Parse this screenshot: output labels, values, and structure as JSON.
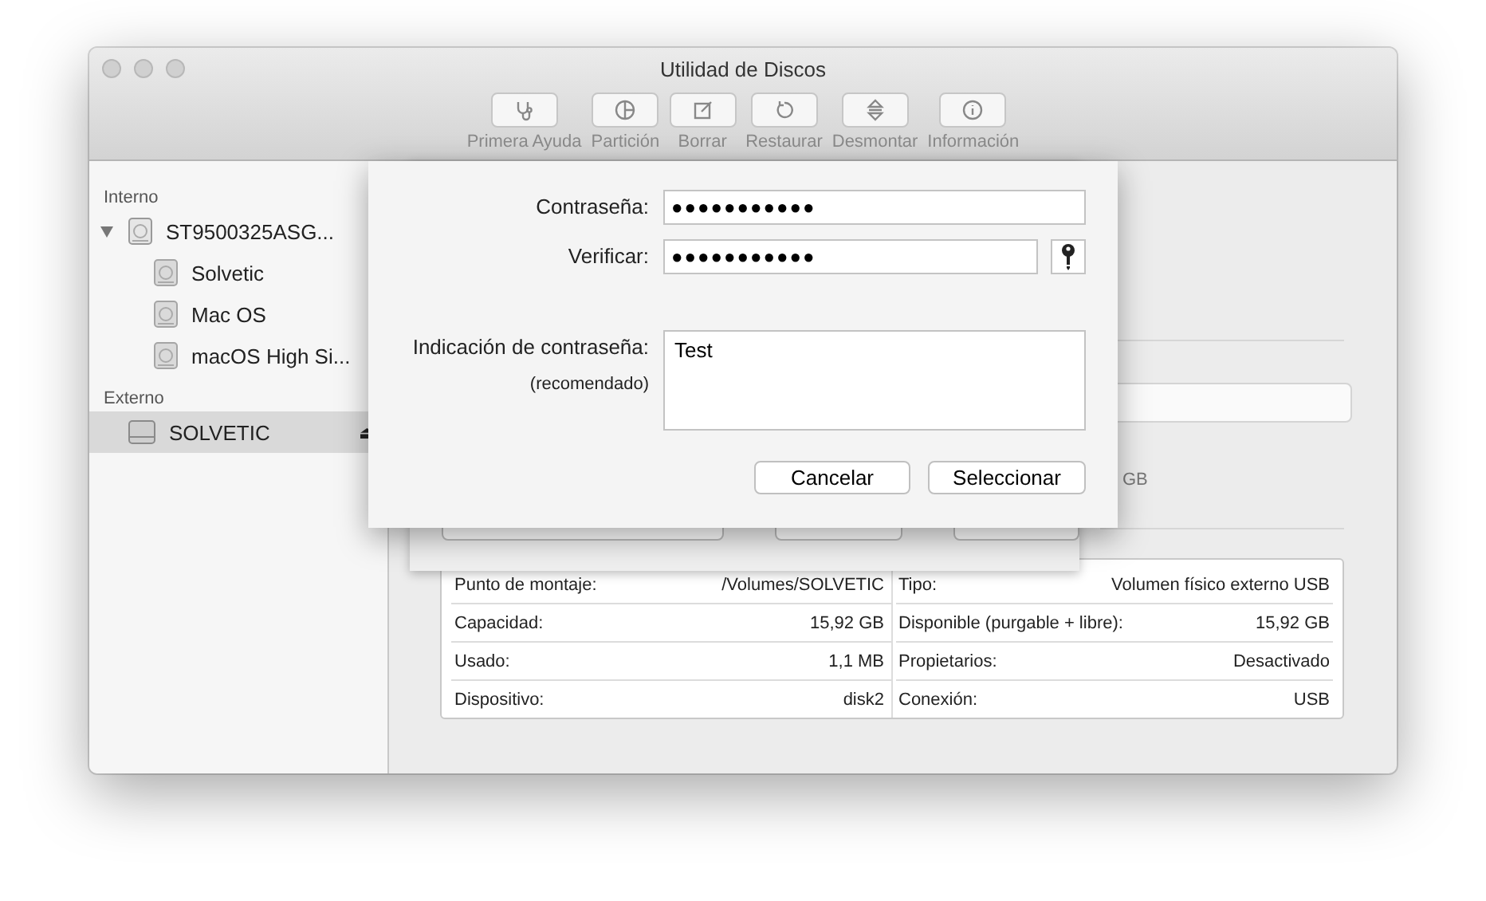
{
  "window": {
    "title": "Utilidad de Discos"
  },
  "toolbar": [
    {
      "label": "Primera Ayuda",
      "kind": "stethoscope",
      "disabled": true
    },
    {
      "label": "Partición",
      "kind": "partition",
      "disabled": true
    },
    {
      "label": "Borrar",
      "kind": "erase",
      "disabled": true
    },
    {
      "label": "Restaurar",
      "kind": "restore",
      "disabled": true
    },
    {
      "label": "Desmontar",
      "kind": "unmount",
      "disabled": true
    },
    {
      "label": "Información",
      "kind": "info",
      "disabled": true
    }
  ],
  "sidebar": {
    "sections": [
      {
        "title": "Interno",
        "items": [
          {
            "label": "ST9500325ASG...",
            "kind": "drive",
            "selected": false,
            "expanded": true,
            "children": [
              {
                "label": "Solvetic",
                "kind": "volume",
                "selected": false
              },
              {
                "label": "Mac OS",
                "kind": "volume",
                "selected": false
              },
              {
                "label": "macOS High Si...",
                "kind": "volume",
                "selected": false
              }
            ]
          }
        ]
      },
      {
        "title": "Externo",
        "items": [
          {
            "label": "SOLVETIC",
            "kind": "external",
            "selected": true,
            "eject": "⏏"
          }
        ]
      }
    ]
  },
  "main": {
    "fragment": "GB",
    "info_table": [
      {
        "label": "Punto de montaje:",
        "value": "/Volumes/SOLVETIC"
      },
      {
        "label": "Tipo:",
        "value": "Volumen físico externo USB"
      },
      {
        "label": "Capacidad:",
        "value": "15,92 GB"
      },
      {
        "label": "Disponible (purgable + libre):",
        "value": "15,92 GB"
      },
      {
        "label": "Usado:",
        "value": "1,1 MB"
      },
      {
        "label": "Propietarios:",
        "value": "Desactivado"
      },
      {
        "label": "Dispositivo:",
        "value": "disk2"
      },
      {
        "label": "Conexión:",
        "value": "USB"
      }
    ]
  },
  "erase_sheet": {
    "buttons": [
      {
        "kind": "wide"
      },
      {
        "kind": "narrow"
      },
      {
        "kind": "narrow"
      }
    ]
  },
  "password_dialog": {
    "password": {
      "label": "Contraseña:",
      "value": "●●●●●●●●●●●"
    },
    "verify": {
      "label": "Verificar:",
      "value": "●●●●●●●●●●●"
    },
    "hint": {
      "label": "Indicación de contraseña:",
      "note": "(recomendado)",
      "value": "Test"
    },
    "buttons": [
      "Cancelar",
      "Seleccionar"
    ]
  }
}
